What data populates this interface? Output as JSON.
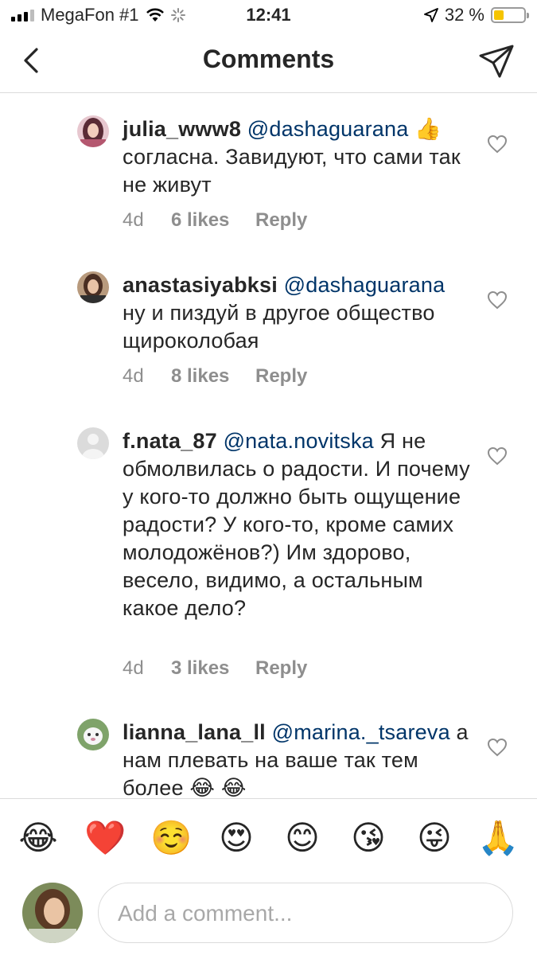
{
  "status_bar": {
    "carrier": "MegaFon #1",
    "time": "12:41",
    "battery_percent": "32 %",
    "battery_level": 0.32
  },
  "nav": {
    "title": "Comments",
    "back_icon": "chevron-left-icon",
    "send_icon": "direct-send-icon"
  },
  "comments": [
    {
      "username": "julia_www8",
      "mention": "@dashaguarana",
      "text": "👍 согласна.  Завидуют, что сами так не живут",
      "age": "4d",
      "likes": "6 likes",
      "reply": "Reply"
    },
    {
      "username": "anastasiyabksi",
      "mention": "@dashaguarana",
      "text": "ну и пиздуй в другое общество щироколобая",
      "age": "4d",
      "likes": "8 likes",
      "reply": "Reply"
    },
    {
      "username": "f.nata_87",
      "mention": "@nata.novitska",
      "text": "Я не обмолвилась о радости. И почему у кого-то должно быть ощущение радости? У кого-то, кроме самих молодожёнов?) Им здорово, весело, видимо, а остальным какое дело?",
      "age": "4d",
      "likes": "3 likes",
      "reply": "Reply"
    },
    {
      "username": "lianna_lana_ll",
      "mention": "@marina._tsareva",
      "text": "а нам плевать на ваше так тем более 😂 😂"
    }
  ],
  "emoji_bar": [
    "😂",
    "❤️",
    "☺️",
    "😍",
    "😊",
    "😘",
    "😜",
    "🙏"
  ],
  "compose": {
    "placeholder": "Add a comment..."
  },
  "colors": {
    "mention": "#003569",
    "meta_text": "#8e8e8e",
    "divider": "#dbdbdb",
    "battery": "#f5c400"
  }
}
